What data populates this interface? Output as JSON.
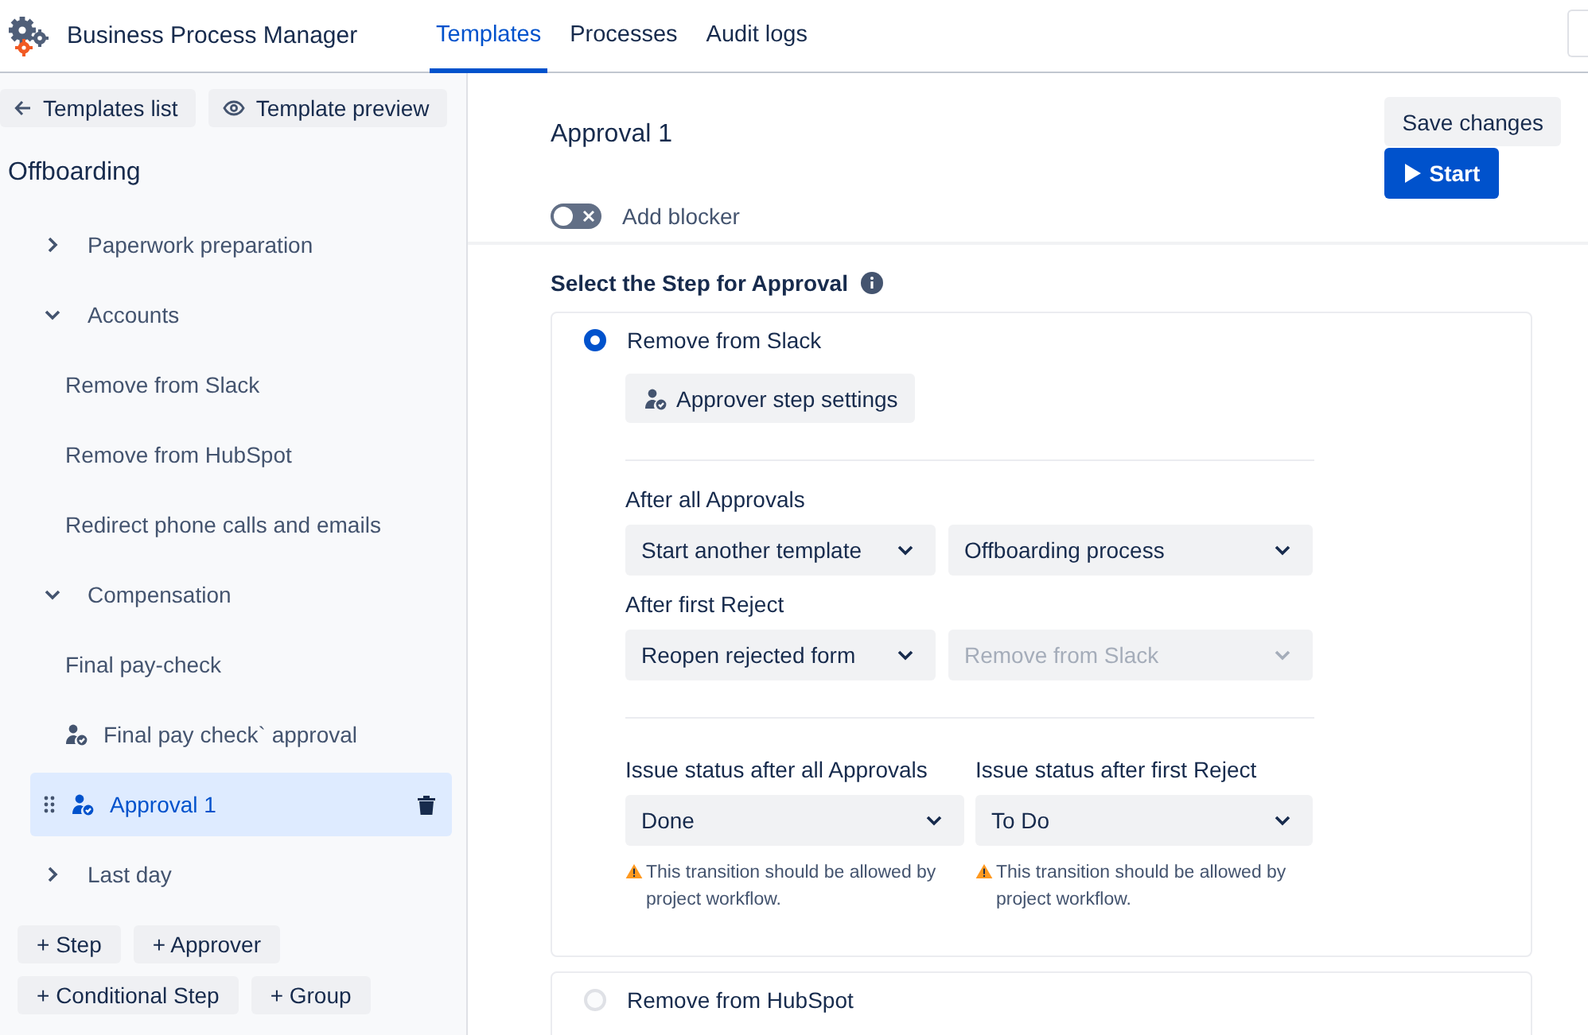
{
  "app": {
    "title": "Business Process Manager"
  },
  "nav_tabs": [
    {
      "label": "Templates",
      "selected": true
    },
    {
      "label": "Processes",
      "selected": false
    },
    {
      "label": "Audit logs",
      "selected": false
    }
  ],
  "sidebar": {
    "back_button": "Templates list",
    "preview_button": "Template preview",
    "template_name": "Offboarding",
    "items": [
      {
        "kind": "group",
        "label": "Paperwork preparation",
        "expanded": false,
        "selected": false
      },
      {
        "kind": "group",
        "label": "Accounts",
        "expanded": true,
        "selected": false,
        "children": [
          {
            "kind": "step",
            "label": "Remove from Slack",
            "selected": false
          },
          {
            "kind": "step",
            "label": "Remove from HubSpot",
            "selected": false
          },
          {
            "kind": "step",
            "label": "Redirect phone calls and emails",
            "selected": false
          }
        ]
      },
      {
        "kind": "group",
        "label": "Compensation",
        "expanded": true,
        "selected": false,
        "children": [
          {
            "kind": "step",
            "label": "Final pay-check",
            "selected": false
          },
          {
            "kind": "approver",
            "label": "Final pay check` approval",
            "selected": false
          },
          {
            "kind": "approver",
            "label": "Approval 1",
            "selected": true
          }
        ]
      },
      {
        "kind": "group",
        "label": "Last day",
        "expanded": false,
        "selected": false
      }
    ],
    "add_buttons": [
      "+ Step",
      "+ Approver",
      "+ Conditional Step",
      "+ Group"
    ]
  },
  "editor": {
    "title": "Approval 1",
    "save_button": "Save changes",
    "start_button": "Start",
    "blocker_toggle": {
      "label": "Add blocker",
      "on": false
    },
    "section_title": "Select the Step for Approval",
    "steps": [
      {
        "label": "Remove from Slack",
        "selected": true,
        "settings_button": "Approver step settings",
        "rules": [
          {
            "label": "After all Approvals",
            "fields": [
              {
                "value": "Start another template",
                "disabled": false
              },
              {
                "value": "Offboarding process",
                "disabled": false
              }
            ]
          },
          {
            "label": "After first Reject",
            "fields": [
              {
                "value": "Reopen rejected form",
                "disabled": false
              },
              {
                "value": "Remove from Slack",
                "disabled": true
              }
            ]
          }
        ],
        "statuses": [
          {
            "label": "Issue status after all Approvals",
            "value": "Done",
            "warning": "This transition should be allowed by project workflow."
          },
          {
            "label": "Issue status after first Reject",
            "value": "To Do",
            "warning": "This transition should be allowed by project workflow."
          }
        ]
      },
      {
        "label": "Remove from HubSpot",
        "selected": false
      }
    ]
  }
}
